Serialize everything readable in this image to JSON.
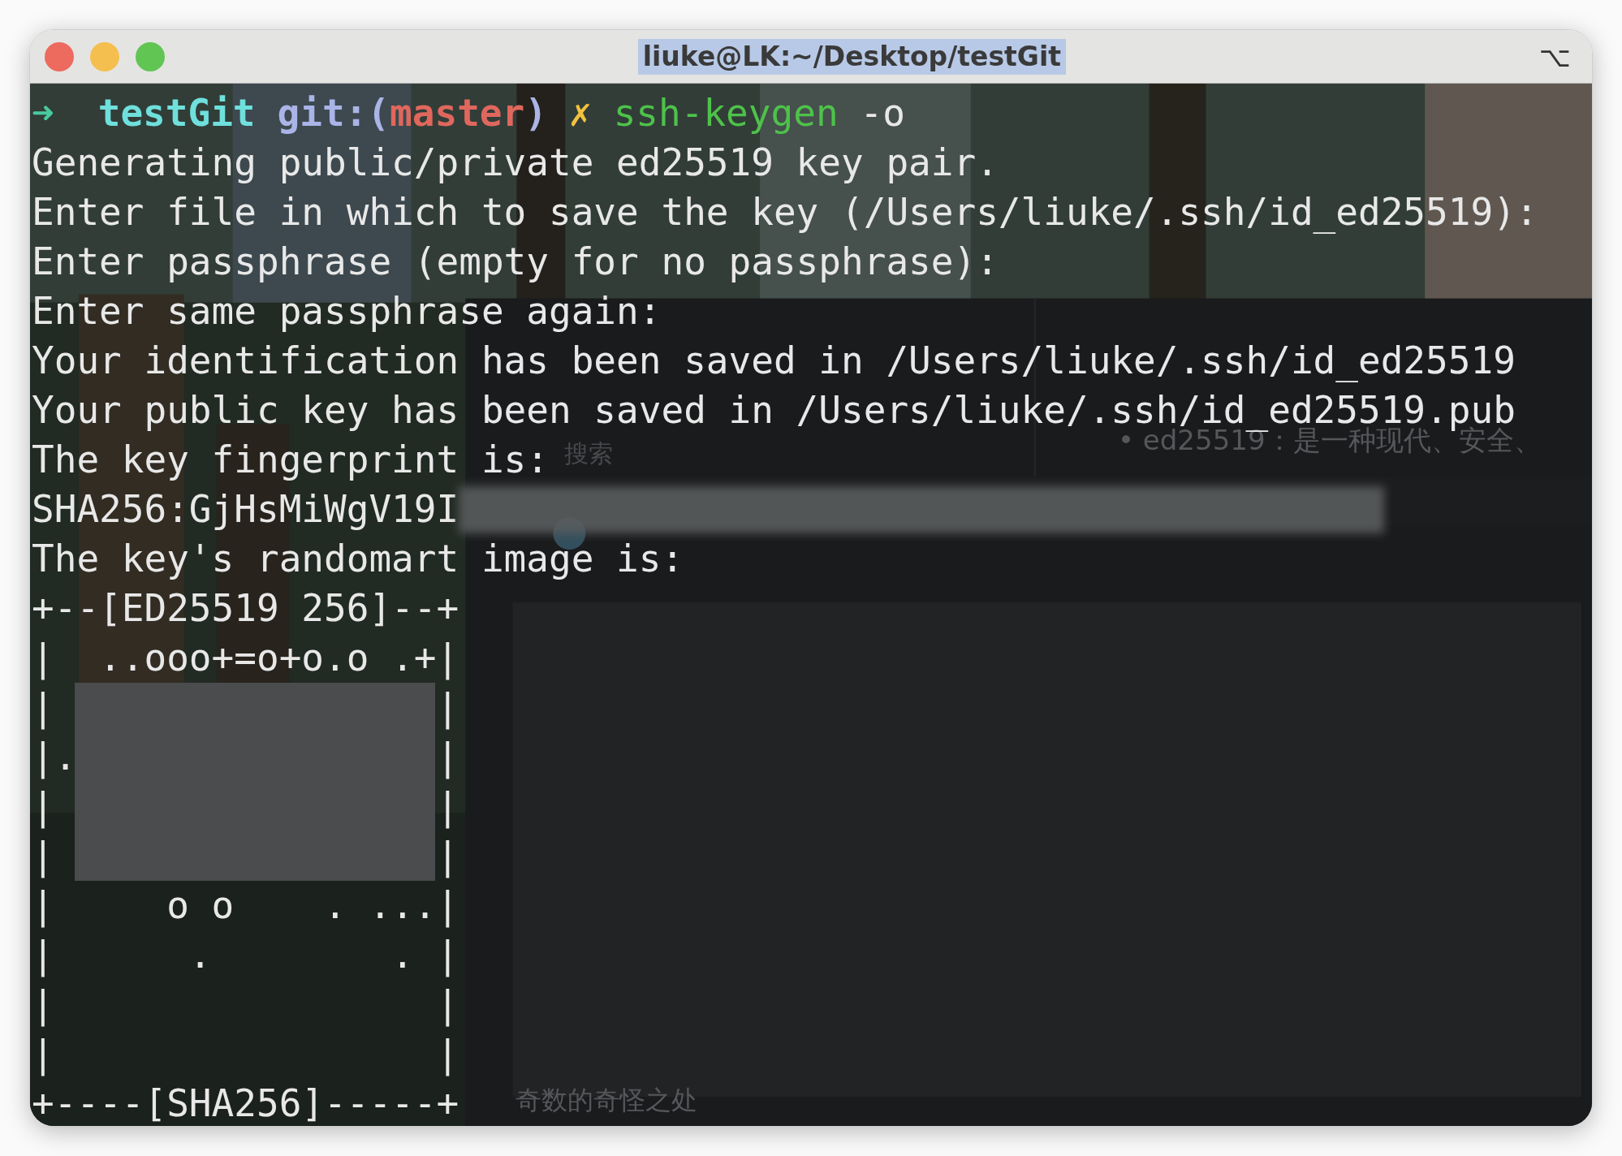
{
  "window": {
    "title": "liuke@LK:~/Desktop/testGit",
    "title_highlighted": true,
    "shortcut": "⌥"
  },
  "backdrop_texts": [
    {
      "text": "• ed25519：是一种现代、安全、",
      "kind": "app-text"
    },
    {
      "text": "搜索",
      "kind": "app-search"
    },
    {
      "text": "奇数的奇怪之处",
      "kind": "app-item"
    }
  ],
  "terminal": {
    "lines": [
      {
        "segments": [
          {
            "kind": "arrow",
            "text": "➜"
          },
          {
            "kind": "directory",
            "text": "testGit"
          },
          {
            "kind": "git",
            "text": "git:("
          },
          {
            "kind": "branch",
            "text": "master"
          },
          {
            "kind": "git",
            "text": ")"
          },
          {
            "kind": "dirty",
            "text": "✗"
          },
          {
            "kind": "command",
            "text": "ssh-keygen"
          },
          {
            "kind": "plain",
            "text": "-o"
          }
        ]
      },
      {
        "text": "Generating public/private ed25519 key pair."
      },
      {
        "text": "Enter file in which to save the key (/Users/liuke/.ssh/id_ed25519):"
      },
      {
        "text": "Enter passphrase (empty for no passphrase):"
      },
      {
        "text": "Enter same passphrase again:"
      },
      {
        "text": "Your identification has been saved in /Users/liuke/.ssh/id_ed25519"
      },
      {
        "text": "Your public key has been saved in /Users/liuke/.ssh/id_ed25519.pub"
      },
      {
        "text": "The key fingerprint is:"
      },
      {
        "text": "SHA256:GjHsMiWgV19I",
        "redacted": true
      },
      {
        "text": "The key's randomart image is:"
      },
      {
        "text": "+--[ED25519 256]--+"
      },
      {
        "text": "|  ..ooo+=o+o.o .+|"
      },
      {
        "text": "|                 |",
        "redacted": true
      },
      {
        "text": "|.                |",
        "redacted": true
      },
      {
        "text": "|                 |",
        "redacted": true
      },
      {
        "text": "|                 |",
        "redacted": true
      },
      {
        "text": "|     o o    . ...|"
      },
      {
        "text": "|      .        . |"
      },
      {
        "text": "|                 |"
      },
      {
        "text": "|                 |"
      },
      {
        "text": "+----[SHA256]-----+"
      }
    ]
  }
}
